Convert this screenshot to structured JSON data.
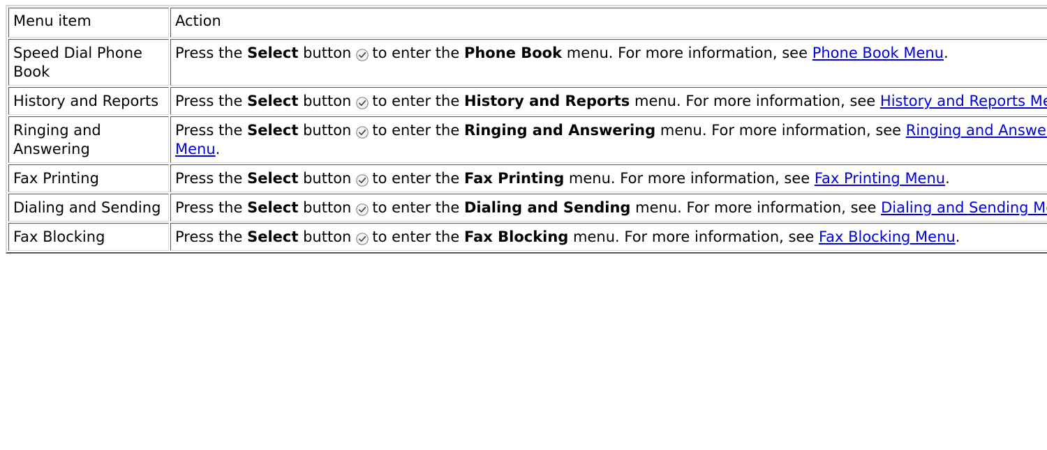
{
  "table": {
    "header": {
      "col1": "Menu item",
      "col2": "Action"
    },
    "common": {
      "press_the": "Press the",
      "select_label": "Select",
      "button_word": "button",
      "to_enter_the": "to enter the",
      "menu_for_more": "menu. For more information, see",
      "period": ".",
      "icon": "select-button-icon"
    },
    "rows": [
      {
        "item": "Speed Dial Phone Book",
        "menu": "Phone Book",
        "link": "Phone Book Menu"
      },
      {
        "item": "History and Reports",
        "menu": "History and Reports",
        "link": "History and Reports Menu"
      },
      {
        "item": "Ringing and Answering",
        "menu": "Ringing and Answering",
        "link": "Ringing and Answering Menu"
      },
      {
        "item": "Fax Printing",
        "menu": "Fax Printing",
        "link": "Fax Printing Menu"
      },
      {
        "item": "Dialing and Sending",
        "menu": "Dialing and Sending",
        "link": "Dialing and Sending Menu"
      },
      {
        "item": "Fax Blocking",
        "menu": "Fax Blocking",
        "link": "Fax Blocking Menu"
      }
    ]
  }
}
